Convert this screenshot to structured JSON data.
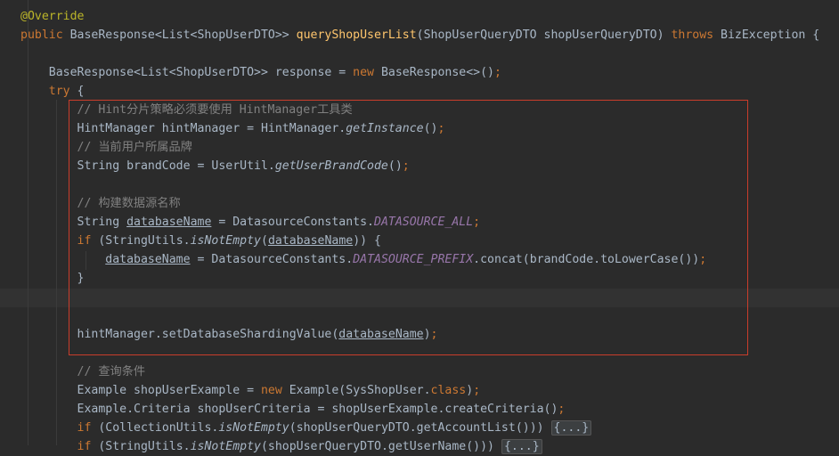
{
  "editor": {
    "lines": [
      {
        "indent": "",
        "tokens": [
          {
            "t": "ann",
            "v": "@Override"
          }
        ]
      },
      {
        "indent": "",
        "tokens": [
          {
            "t": "kw",
            "v": "public "
          },
          {
            "t": "plain",
            "v": "BaseResponse<List<ShopUserDTO>> "
          },
          {
            "t": "fn",
            "v": "queryShopUserList"
          },
          {
            "t": "plain",
            "v": "(ShopUserQueryDTO shopUserQueryDTO) "
          },
          {
            "t": "kw",
            "v": "throws "
          },
          {
            "t": "plain",
            "v": "BizException {"
          }
        ]
      },
      {
        "indent": "",
        "tokens": []
      },
      {
        "indent": "    ",
        "tokens": [
          {
            "t": "plain",
            "v": "BaseResponse<List<ShopUserDTO>> response = "
          },
          {
            "t": "kw",
            "v": "new "
          },
          {
            "t": "plain",
            "v": "BaseResponse<>()"
          },
          {
            "t": "kw",
            "v": ";"
          }
        ]
      },
      {
        "indent": "    ",
        "tokens": [
          {
            "t": "kw",
            "v": "try "
          },
          {
            "t": "plain",
            "v": "{"
          }
        ]
      },
      {
        "indent": "        ",
        "tokens": [
          {
            "t": "cmt",
            "v": "// Hint分片策略必须要使用 HintManager工具类"
          }
        ]
      },
      {
        "indent": "        ",
        "tokens": [
          {
            "t": "plain",
            "v": "HintManager hintManager = HintManager."
          },
          {
            "t": "it",
            "v": "getInstance"
          },
          {
            "t": "plain",
            "v": "()"
          },
          {
            "t": "kw",
            "v": ";"
          }
        ]
      },
      {
        "indent": "        ",
        "tokens": [
          {
            "t": "cmt",
            "v": "// 当前用户所属品牌"
          }
        ]
      },
      {
        "indent": "        ",
        "tokens": [
          {
            "t": "plain",
            "v": "String brandCode = UserUtil."
          },
          {
            "t": "it",
            "v": "getUserBrandCode"
          },
          {
            "t": "plain",
            "v": "()"
          },
          {
            "t": "kw",
            "v": ";"
          }
        ]
      },
      {
        "indent": "",
        "tokens": []
      },
      {
        "indent": "        ",
        "tokens": [
          {
            "t": "cmt",
            "v": "// 构建数据源名称"
          }
        ]
      },
      {
        "indent": "        ",
        "tokens": [
          {
            "t": "plain",
            "v": "String "
          },
          {
            "t": "ul",
            "v": "databaseName"
          },
          {
            "t": "plain",
            "v": " = DatasourceConstants."
          },
          {
            "t": "const",
            "v": "DATASOURCE_ALL"
          },
          {
            "t": "kw",
            "v": ";"
          }
        ]
      },
      {
        "indent": "        ",
        "tokens": [
          {
            "t": "kw",
            "v": "if "
          },
          {
            "t": "plain",
            "v": "(StringUtils."
          },
          {
            "t": "it",
            "v": "isNotEmpty"
          },
          {
            "t": "plain",
            "v": "("
          },
          {
            "t": "ul",
            "v": "databaseName"
          },
          {
            "t": "plain",
            "v": ")) {"
          }
        ]
      },
      {
        "indent": "            ",
        "tokens": [
          {
            "t": "ul",
            "v": "databaseName"
          },
          {
            "t": "plain",
            "v": " = DatasourceConstants."
          },
          {
            "t": "const",
            "v": "DATASOURCE_PREFIX"
          },
          {
            "t": "plain",
            "v": ".concat(brandCode.toLowerCase())"
          },
          {
            "t": "kw",
            "v": ";"
          }
        ]
      },
      {
        "indent": "        ",
        "tokens": [
          {
            "t": "plain",
            "v": "}"
          }
        ]
      },
      {
        "indent": "",
        "tokens": []
      },
      {
        "indent": "",
        "tokens": []
      },
      {
        "indent": "        ",
        "tokens": [
          {
            "t": "plain",
            "v": "hintManager.setDatabaseShardingValue("
          },
          {
            "t": "ul",
            "v": "databaseName"
          },
          {
            "t": "plain",
            "v": ")"
          },
          {
            "t": "kw",
            "v": ";"
          }
        ]
      },
      {
        "indent": "",
        "tokens": []
      },
      {
        "indent": "        ",
        "tokens": [
          {
            "t": "cmt",
            "v": "// 查询条件"
          }
        ]
      },
      {
        "indent": "        ",
        "tokens": [
          {
            "t": "plain",
            "v": "Example shopUserExample = "
          },
          {
            "t": "kw",
            "v": "new "
          },
          {
            "t": "plain",
            "v": "Example(SysShopUser."
          },
          {
            "t": "kw",
            "v": "class"
          },
          {
            "t": "plain",
            "v": ")"
          },
          {
            "t": "kw",
            "v": ";"
          }
        ]
      },
      {
        "indent": "        ",
        "tokens": [
          {
            "t": "plain",
            "v": "Example.Criteria shopUserCriteria = shopUserExample.createCriteria()"
          },
          {
            "t": "kw",
            "v": ";"
          }
        ]
      },
      {
        "indent": "        ",
        "tokens": [
          {
            "t": "kw",
            "v": "if "
          },
          {
            "t": "plain",
            "v": "(CollectionUtils."
          },
          {
            "t": "it",
            "v": "isNotEmpty"
          },
          {
            "t": "plain",
            "v": "(shopUserQueryDTO.getAccountList())) "
          },
          {
            "t": "fold",
            "v": "{...}"
          }
        ]
      },
      {
        "indent": "        ",
        "tokens": [
          {
            "t": "kw",
            "v": "if "
          },
          {
            "t": "plain",
            "v": "(StringUtils."
          },
          {
            "t": "it",
            "v": "isNotEmpty"
          },
          {
            "t": "plain",
            "v": "(shopUserQueryDTO.getUserName())) "
          },
          {
            "t": "fold",
            "v": "{...}"
          }
        ]
      }
    ]
  },
  "colors": {
    "background": "#2b2b2b",
    "highlight_box": "#c93d2b",
    "keyword": "#cc7832",
    "annotation": "#bbb529",
    "method_decl": "#ffc66d",
    "comment": "#808080",
    "constant": "#9876aa",
    "text": "#a9b7c6"
  }
}
